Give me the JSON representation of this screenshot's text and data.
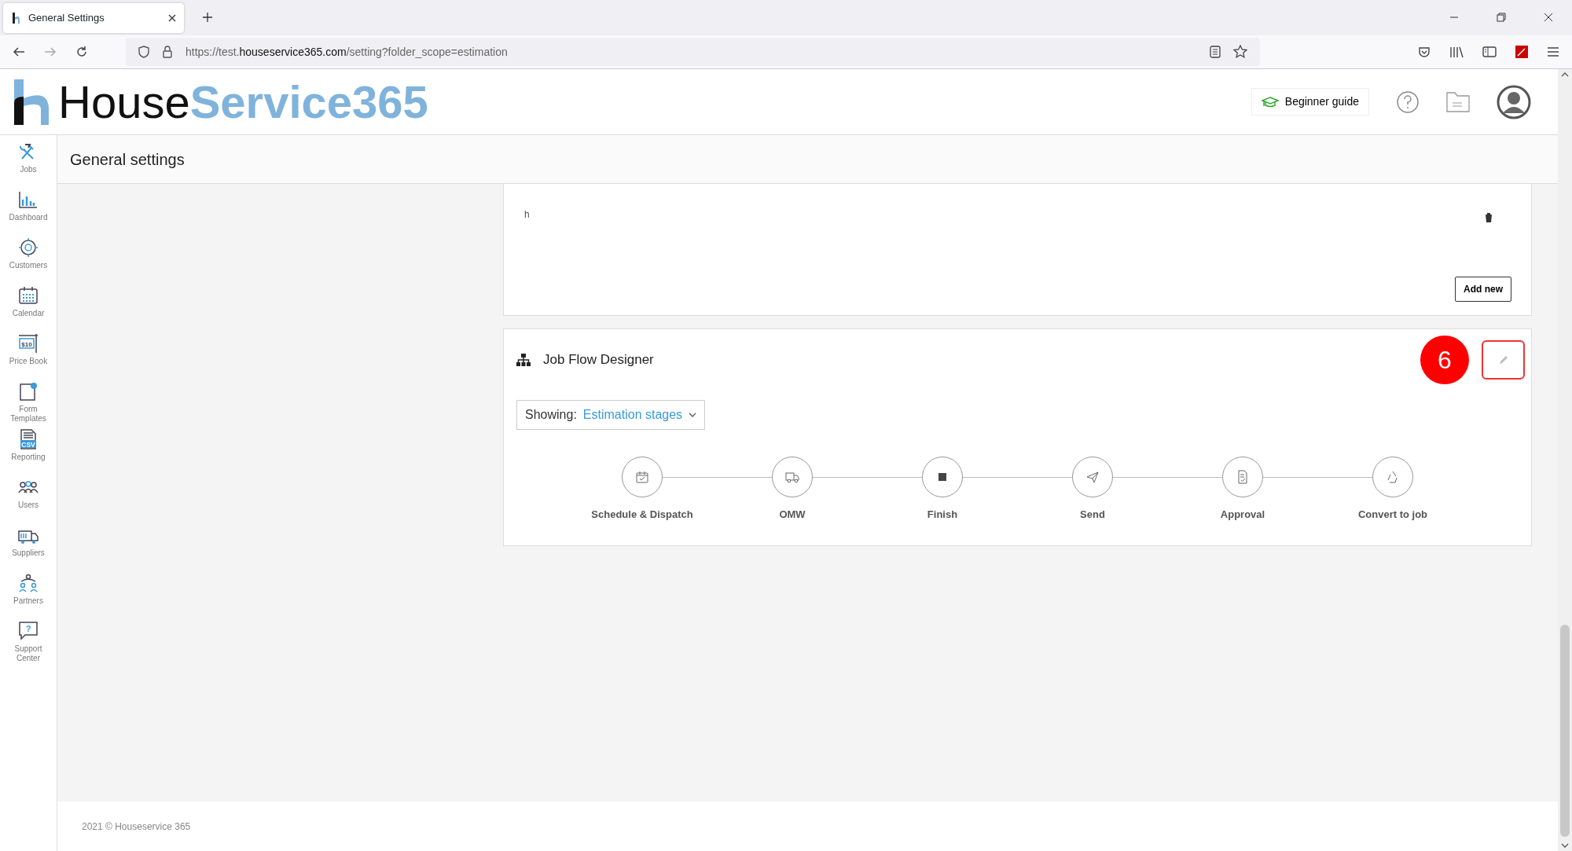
{
  "browser": {
    "tab_title": "General Settings",
    "url": {
      "prefix": "https://test.",
      "domain": "houseservice365.com",
      "path": "/setting?folder_scope=estimation"
    }
  },
  "header": {
    "logo": {
      "part1": "House",
      "part2": "Service365"
    },
    "guide_button": "Beginner guide"
  },
  "sidebar": {
    "items": [
      {
        "label": "Jobs",
        "kind": "tools"
      },
      {
        "label": "Dashboard",
        "kind": "chart"
      },
      {
        "label": "Customers",
        "kind": "target"
      },
      {
        "label": "Calendar",
        "kind": "calendar"
      },
      {
        "label": "Price Book",
        "kind": "price",
        "icon_text": "$10"
      },
      {
        "label": "Form Templates",
        "kind": "form"
      },
      {
        "label": "Reporting",
        "kind": "csv",
        "icon_text": "CSV"
      },
      {
        "label": "Users",
        "kind": "users"
      },
      {
        "label": "Suppliers",
        "kind": "truck"
      },
      {
        "label": "Partners",
        "kind": "partners"
      },
      {
        "label": "Support Center",
        "kind": "support",
        "icon_text": "?"
      }
    ]
  },
  "page_title": "General settings",
  "notes_card": {
    "entry": "h",
    "add_button": "Add new"
  },
  "job_flow": {
    "title": "Job Flow Designer",
    "step_badge": "6",
    "edit_highlighted": true,
    "showing_label": "Showing:",
    "showing_value": "Estimation stages",
    "stages": [
      {
        "label": "Schedule & Dispatch",
        "kind": "calendar"
      },
      {
        "label": "OMW",
        "kind": "truck"
      },
      {
        "label": "Finish",
        "kind": "stop"
      },
      {
        "label": "Send",
        "kind": "plane"
      },
      {
        "label": "Approval",
        "kind": "document"
      },
      {
        "label": "Convert to job",
        "kind": "recycle"
      }
    ]
  },
  "footer": "2021 © Houseservice 365"
}
